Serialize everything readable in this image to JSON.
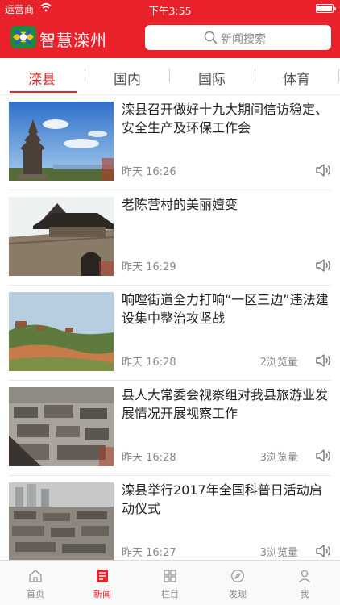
{
  "status_bar": {
    "carrier": "运营商",
    "time": "下午3:55"
  },
  "app": {
    "title": "智慧滦州",
    "search_placeholder": "新闻搜索",
    "accent_color": "#e8212a"
  },
  "tabs": [
    {
      "label": "滦县",
      "active": true
    },
    {
      "label": "国内",
      "active": false
    },
    {
      "label": "国际",
      "active": false
    },
    {
      "label": "体育",
      "active": false
    }
  ],
  "news": [
    {
      "title": "滦县召开做好十九大期间信访稳定、安全生产及环保工作会",
      "time": "昨天 16:26",
      "views": "",
      "thumb": "pagoda-photo"
    },
    {
      "title": "老陈营村的美丽嬗变",
      "time": "昨天 16:29",
      "views": "",
      "thumb": "city-gate-photo"
    },
    {
      "title": "响嘡街道全力打响“一区三边”违法建设集中整治攻坚战",
      "time": "昨天 16:28",
      "views": "2浏览量",
      "thumb": "hillside-photo"
    },
    {
      "title": "县人大常委会视察组对我县旅游业发展情况开展视察工作",
      "time": "昨天 16:28",
      "views": "3浏览量",
      "thumb": "old-town-photo"
    },
    {
      "title": "滦县举行2017年全国科普日活动启动仪式",
      "time": "昨天 16:27",
      "views": "3浏览量",
      "thumb": "town-aerial-photo"
    }
  ],
  "bottom_nav": [
    {
      "label": "首页",
      "icon": "home-icon",
      "active": false
    },
    {
      "label": "新闻",
      "icon": "news-icon",
      "active": true
    },
    {
      "label": "栏目",
      "icon": "grid-icon",
      "active": false
    },
    {
      "label": "发现",
      "icon": "compass-icon",
      "active": false
    },
    {
      "label": "我",
      "icon": "person-icon",
      "active": false
    }
  ]
}
